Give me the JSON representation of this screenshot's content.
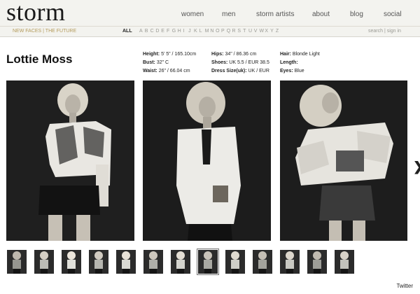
{
  "header": {
    "logo": "storm",
    "nav": [
      "women",
      "men",
      "storm artists",
      "about",
      "blog",
      "social"
    ]
  },
  "subbar": {
    "new_faces": "NEW FACES | THE FUTURE",
    "all": "ALL",
    "letters": [
      "A",
      "B",
      "C",
      "D",
      "E",
      "F",
      "G",
      "H",
      "I",
      "J",
      "K",
      "L",
      "M",
      "N",
      "O",
      "P",
      "Q",
      "R",
      "S",
      "T",
      "U",
      "V",
      "W",
      "X",
      "Y",
      "Z"
    ],
    "account": "search | sign in"
  },
  "model": {
    "name": "Lottie Moss",
    "stats_col1": [
      {
        "label": "Height:",
        "value": "5' 5\" / 165.10cm"
      },
      {
        "label": "Bust:",
        "value": "32\" C"
      },
      {
        "label": "Waist:",
        "value": "26\" / 66.04 cm"
      }
    ],
    "stats_col2": [
      {
        "label": "Hips:",
        "value": "34\" / 86.36 cm"
      },
      {
        "label": "Shoes:",
        "value": "UK 5.5 / EUR 38.5"
      },
      {
        "label": "Dress Size(uk):",
        "value": "UK / EUR"
      }
    ],
    "stats_col3": [
      {
        "label": "Hair:",
        "value": "Blonde Light"
      },
      {
        "label": "Length:",
        "value": ""
      },
      {
        "label": "Eyes:",
        "value": "Blue"
      }
    ]
  },
  "gallery": {
    "photos": [
      "photo-lace-blouse",
      "photo-white-blazer",
      "photo-ruffle-blouse"
    ],
    "next_icon": "chevron-right-icon",
    "thumbnail_count": 13,
    "active_thumbnail": 7
  },
  "credit": "Twitter"
}
